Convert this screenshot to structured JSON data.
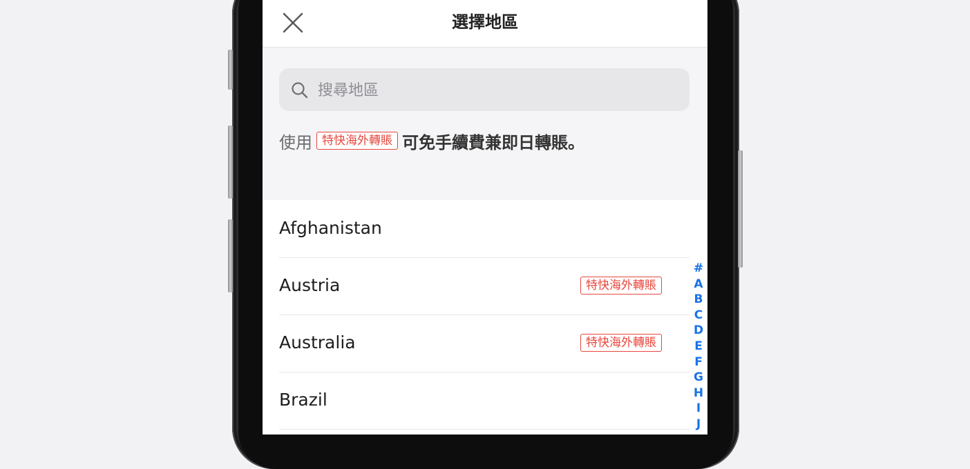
{
  "header": {
    "title": "選擇地區",
    "close_icon": "close-icon"
  },
  "search": {
    "placeholder": "搜尋地區",
    "value": "",
    "icon": "search-icon"
  },
  "promo": {
    "prefix": "使用",
    "badge": "特快海外轉賬",
    "suffix": "可免手續費兼即日轉賬。"
  },
  "countries": [
    {
      "name": "Afghanistan",
      "badge": ""
    },
    {
      "name": "Austria",
      "badge": "特快海外轉賬"
    },
    {
      "name": "Australia",
      "badge": "特快海外轉賬"
    },
    {
      "name": "Brazil",
      "badge": ""
    }
  ],
  "index": [
    "#",
    "A",
    "B",
    "C",
    "D",
    "E",
    "F",
    "G",
    "H",
    "I",
    "J"
  ],
  "colors": {
    "accent_blue": "#1a73e8",
    "badge_red": "#e8463d",
    "background": "#f5f5f7"
  }
}
